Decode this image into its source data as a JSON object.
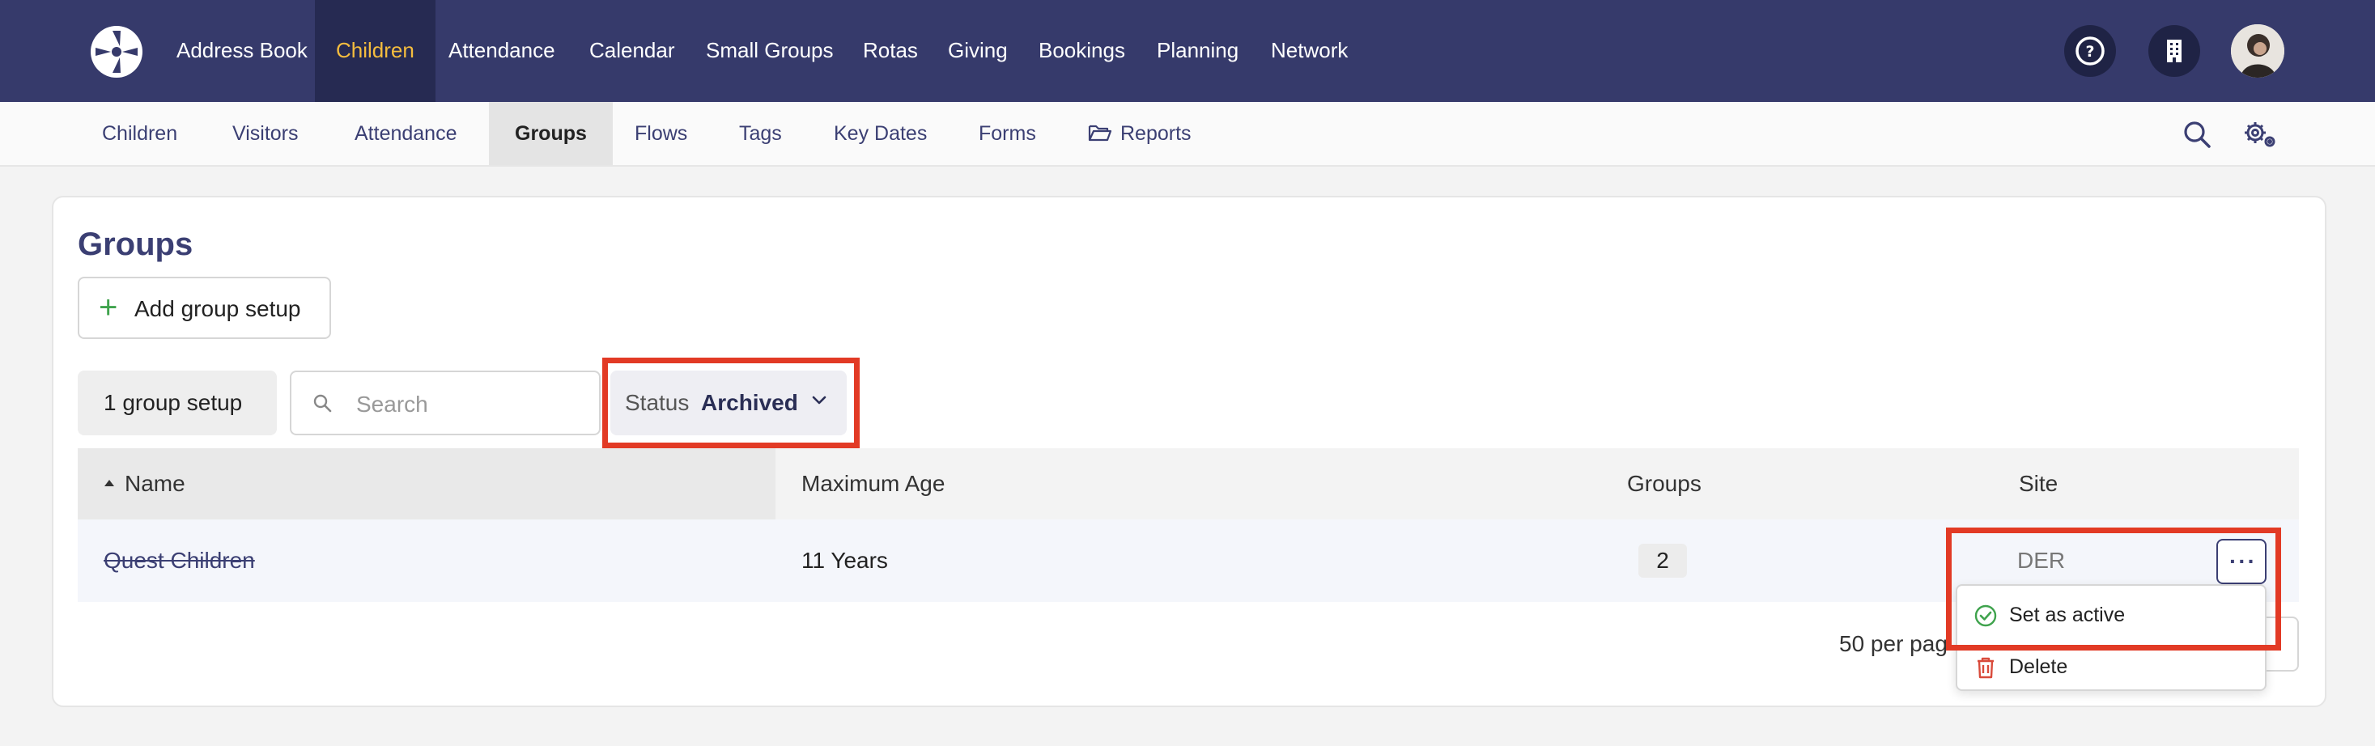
{
  "top_nav": {
    "items": [
      "Address Book",
      "Children",
      "Attendance",
      "Calendar",
      "Small Groups",
      "Rotas",
      "Giving",
      "Bookings",
      "Planning",
      "Network"
    ],
    "active": "Children",
    "icons": [
      "help-icon",
      "building-icon"
    ]
  },
  "sub_nav": {
    "items": [
      "Children",
      "Visitors",
      "Attendance",
      "Groups",
      "Flows",
      "Tags",
      "Key Dates",
      "Forms",
      "Reports"
    ],
    "active": "Groups",
    "icons": [
      "search-icon",
      "settings-gear-icon"
    ]
  },
  "page": {
    "title": "Groups",
    "add_button": "Add group setup",
    "count_label": "1 group setup",
    "search_placeholder": "Search",
    "status_filter": {
      "label": "Status",
      "value": "Archived"
    }
  },
  "table": {
    "columns": [
      "Name",
      "Maximum Age",
      "Groups",
      "Site"
    ],
    "sort": {
      "column": "Name",
      "direction": "ascending"
    },
    "rows": [
      {
        "name": "Quest Children",
        "max_age": "11 Years",
        "groups": "2",
        "site": "DER"
      }
    ],
    "per_page": "50 per pag"
  },
  "row_menu": {
    "items": [
      {
        "label": "Set as active",
        "icon": "check-circle-icon"
      },
      {
        "label": "Delete",
        "icon": "trash-icon"
      }
    ]
  },
  "colors": {
    "nav_bg": "#363a6b",
    "nav_active_text": "#f5bd3e",
    "highlight": "#e23a25",
    "accent_text": "#3b3f73"
  }
}
